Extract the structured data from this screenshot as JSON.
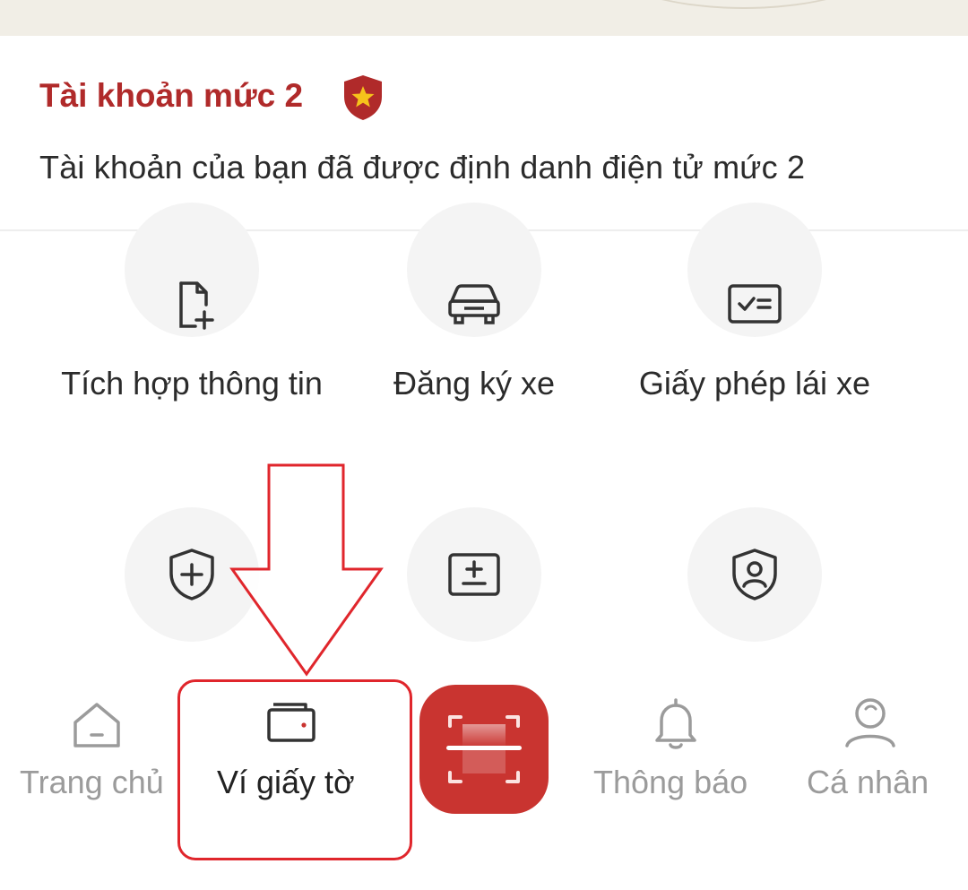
{
  "account": {
    "level_title": "Tài khoản mức 2",
    "description": "Tài khoản của bạn đã được định danh điện tử mức 2",
    "badge_icon": "star-shield-icon"
  },
  "services": [
    {
      "label": "Tích hợp thông tin",
      "icon": "document-add-icon"
    },
    {
      "label": "Đăng ký xe",
      "icon": "car-icon"
    },
    {
      "label": "Giấy phép lái xe",
      "icon": "license-card-icon"
    },
    {
      "label": "",
      "icon": "shield-plus-icon"
    },
    {
      "label": "",
      "icon": "plus-minus-box-icon"
    },
    {
      "label": "",
      "icon": "shield-user-icon"
    }
  ],
  "nav": {
    "home": "Trang chủ",
    "wallet": "Ví giấy tờ",
    "notifications": "Thông báo",
    "profile": "Cá nhân",
    "active": "wallet"
  },
  "colors": {
    "brand_red": "#c93430",
    "title_red": "#b02a2a",
    "annotation_red": "#e0262c",
    "inactive_gray": "#9b9b9b"
  }
}
